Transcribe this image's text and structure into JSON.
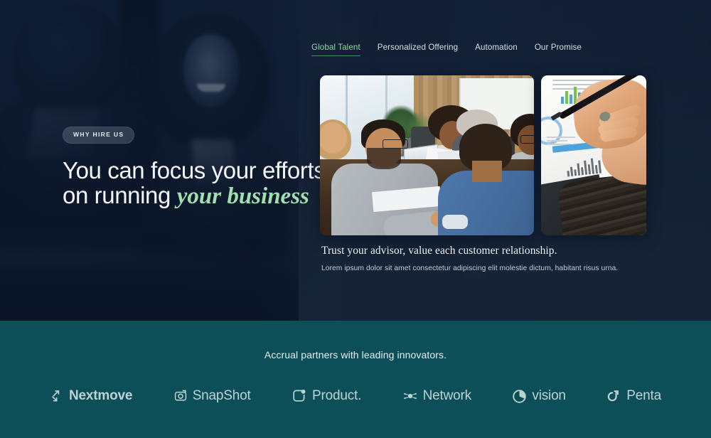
{
  "nav": {
    "items": [
      {
        "label": "Global Talent",
        "active": true
      },
      {
        "label": "Personalized Offering",
        "active": false
      },
      {
        "label": "Automation",
        "active": false
      },
      {
        "label": "Our Promise",
        "active": false
      }
    ]
  },
  "hero": {
    "badge": "WHY HIRE US",
    "headline_line1": "You can focus your efforts",
    "headline_line2_plain": "on running ",
    "headline_line2_accent": "your business",
    "accent_color": "#9fe0ae",
    "background_alt": "Two business colleagues talking, dark blue tinted photo"
  },
  "cards": [
    {
      "name": "meeting-photo",
      "alt": "Team of colleagues reviewing documents around a conference table"
    },
    {
      "name": "chart-photo",
      "alt": "Hand holding a pen over printed bar chart reports"
    }
  ],
  "caption": {
    "title": "Trust your advisor, value each customer relationship.",
    "subtitle": "Lorem ipsum dolor sit amet consectetur adipiscing elit molestie dictum, habitant  risus urna."
  },
  "partners": {
    "title": "Accrual partners with leading innovators.",
    "background_color": "#0d4f59",
    "text_color": "#bcd3d3",
    "logos": [
      {
        "name": "Nextmove",
        "icon": "arrows-icon",
        "bold": true
      },
      {
        "name": "SnapShot",
        "icon": "camera-icon",
        "bold": false
      },
      {
        "name": "Product.",
        "icon": "rounded-square-dot-icon",
        "bold": false
      },
      {
        "name": "Network",
        "icon": "star-burst-icon",
        "bold": false
      },
      {
        "name": "vision",
        "icon": "pie-circle-icon",
        "bold": false
      },
      {
        "name": "Penta",
        "icon": "curved-arrow-icon",
        "bold": false
      }
    ]
  }
}
